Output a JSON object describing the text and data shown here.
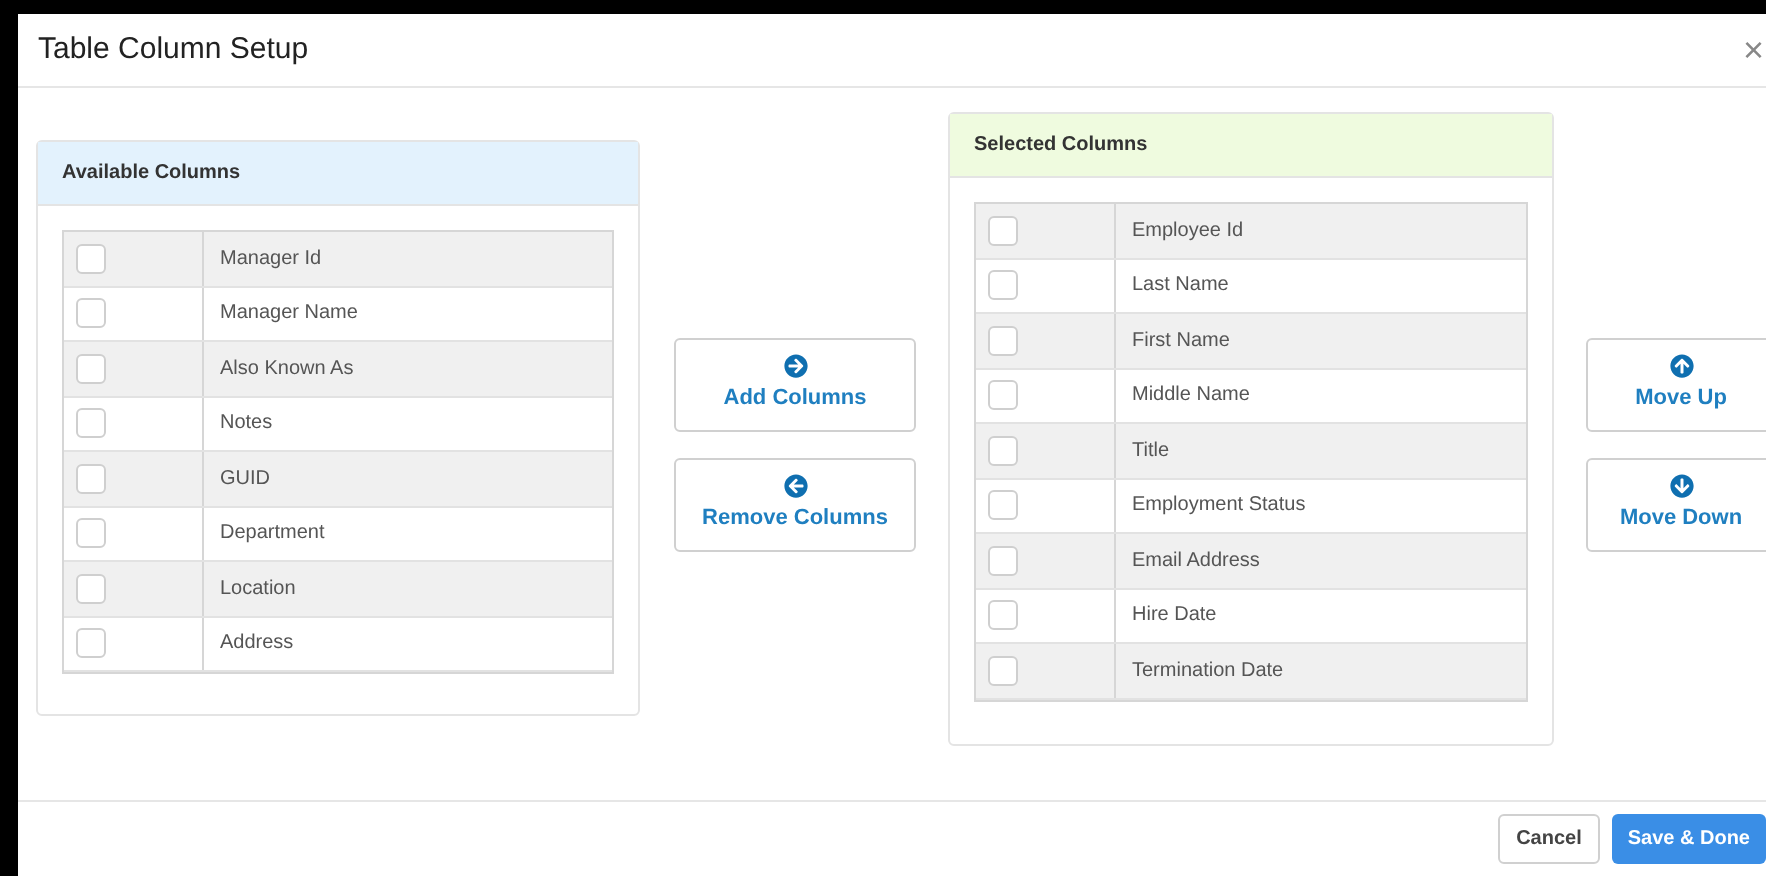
{
  "window": {
    "title": "Table Column Setup",
    "close": "×"
  },
  "available": {
    "title": "Available Columns",
    "rows": [
      {
        "label": "Manager Id",
        "checked": false
      },
      {
        "label": "Manager Name",
        "checked": false
      },
      {
        "label": "Also Known As",
        "checked": false
      },
      {
        "label": "Notes",
        "checked": false
      },
      {
        "label": "GUID",
        "checked": false
      },
      {
        "label": "Department",
        "checked": false
      },
      {
        "label": "Location",
        "checked": false
      },
      {
        "label": "Address",
        "checked": false
      }
    ]
  },
  "transfer_buttons": [
    {
      "label": "Add Columns",
      "kind": "right"
    },
    {
      "label": "Remove Columns",
      "kind": "left"
    }
  ],
  "selected": {
    "title": "Selected Columns",
    "rows": [
      {
        "label": "Employee Id",
        "checked": false
      },
      {
        "label": "Last Name",
        "checked": false
      },
      {
        "label": "First Name",
        "checked": false
      },
      {
        "label": "Middle Name",
        "checked": false
      },
      {
        "label": "Title",
        "checked": false
      },
      {
        "label": "Employment Status",
        "checked": false
      },
      {
        "label": "Email Address",
        "checked": false
      },
      {
        "label": "Hire Date",
        "checked": false
      },
      {
        "label": "Termination Date",
        "checked": false
      }
    ]
  },
  "move_buttons": [
    {
      "label": "Move Up",
      "kind": "up"
    },
    {
      "label": "Move Down",
      "kind": "down"
    }
  ],
  "footer_buttons": [
    {
      "label": "Cancel",
      "kind": "secondary"
    },
    {
      "label": "Save & Done",
      "kind": "primary"
    }
  ]
}
